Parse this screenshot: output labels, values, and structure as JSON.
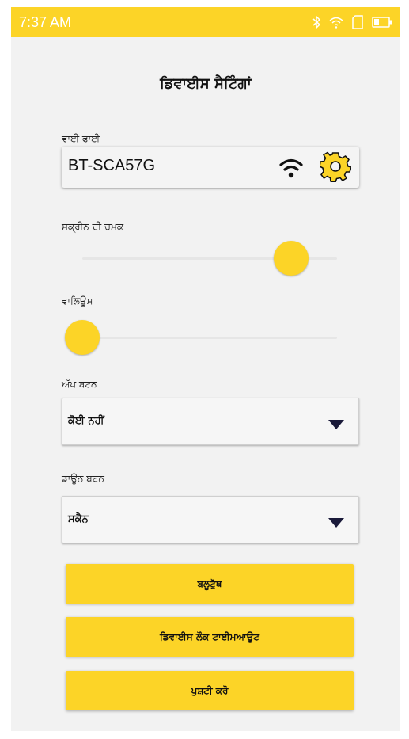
{
  "status_bar": {
    "time": "7:37 AM",
    "icons": [
      "bluetooth-icon",
      "wifi-icon",
      "sim-icon",
      "battery-icon"
    ]
  },
  "page": {
    "title": "ਡਿਵਾਈਸ ਸੈਟਿੰਗਾਂ"
  },
  "wifi": {
    "label": "ਵਾਈ ਫਾਈ",
    "network": "BT-SCA57G"
  },
  "brightness": {
    "label": "ਸਕ੍ਰੀਨ ਦੀ ਚਮਕ",
    "value": 0.82
  },
  "volume": {
    "label": "ਵਾਲਿਊਮ",
    "value": 0.0
  },
  "up_button": {
    "label": "ਅੱਪ ਬਟਨ",
    "selected": "ਕੋਈ ਨਹੀਂ"
  },
  "down_button": {
    "label": "ਡਾਊਨ ਬਟਨ",
    "selected": "ਸਕੈਨ"
  },
  "actions": {
    "bluetooth": "ਬਲੂਟੁੱਥ",
    "lock_timeout": "ਡਿਵਾਈਸ ਲੌਕ ਟਾਈਮਆਊਟ",
    "confirm": "ਪੁਸ਼ਟੀ ਕਰੋ"
  },
  "colors": {
    "accent": "#FCD427",
    "background": "#f2f2f2",
    "text": "#111111"
  }
}
